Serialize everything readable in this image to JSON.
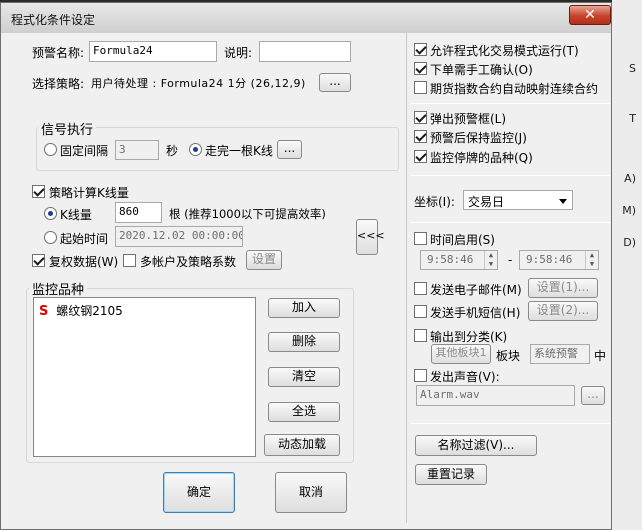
{
  "window": {
    "title": "程式化条件设定",
    "close": "✕"
  },
  "background_right_fragments": [
    "S",
    "T",
    "A)",
    "M)",
    "D)"
  ],
  "left": {
    "alert_name_label": "预警名称:",
    "alert_name_value": "Formula24",
    "description_label": "说明:",
    "description_value": "",
    "strategy_label": "选择策略:",
    "strategy_value": "用户待处理 : Formula24 1分 (26,12,9)",
    "strategy_browse": "...",
    "signal_group": "信号执行",
    "fixed_interval_label": "固定间隔",
    "fixed_interval_value": "3",
    "seconds_unit": "秒",
    "bar_complete_label": "走完一根K线",
    "bar_complete_btn": "...",
    "kline_calc_label": "策略计算K线量",
    "kline_count_label": "K线量",
    "kline_count_value": "860",
    "kline_count_hint": "根 (推荐1000以下可提高效率)",
    "start_time_label": "起始时间",
    "start_time_value": "2020.12.02 00:00:00",
    "restore_data_label": "复权数据(W)",
    "multi_account_label": "多帐户及策略系数",
    "settings_btn": "设置",
    "expand_btn": "<<<",
    "monitor_group": "监控品种",
    "monitor_items": [
      {
        "marker": "S",
        "name": "螺纹钢2105"
      }
    ],
    "add_btn": "加入",
    "delete_btn": "删除",
    "clear_btn": "清空",
    "select_all_btn": "全选",
    "dynamic_load_btn": "动态加载",
    "ok_btn": "确定",
    "cancel_btn": "取消"
  },
  "right": {
    "allow_trade_label": "允许程式化交易模式运行(T)",
    "manual_confirm_label": "下单需手工确认(O)",
    "futures_index_label": "期货指数合约自动映射连续合约",
    "popup_alert_label": "弹出预警框(L)",
    "keep_monitor_label": "预警后保持监控(J)",
    "monitor_suspended_label": "监控停牌的品种(Q)",
    "axis_label": "坐标(I):",
    "axis_value": "交易日",
    "time_enable_label": "时间启用(S)",
    "time_from": "9:58:46",
    "time_dash": "-",
    "time_to": "9:58:46",
    "send_email_label": "发送电子邮件(M)",
    "email_settings_btn": "设置(1)...",
    "send_sms_label": "发送手机短信(H)",
    "sms_settings_btn": "设置(2)...",
    "output_category_label": "输出到分类(K)",
    "other_block_btn": "其他板块1",
    "block_label": "板块",
    "system_alert_value": "系统预警",
    "middle_char": "中",
    "play_sound_label": "发出声音(V):",
    "sound_file_value": "Alarm.wav",
    "sound_browse_btn": "...",
    "name_filter_btn": "名称过滤(V)...",
    "reset_record_btn": "重置记录"
  },
  "state": {
    "fixed_interval": false,
    "bar_complete": true,
    "kline_calc": true,
    "kline_count": true,
    "start_time": false,
    "restore_data": true,
    "multi_account": false,
    "allow_trade": true,
    "manual_confirm": true,
    "futures_index": false,
    "popup_alert": true,
    "keep_monitor": true,
    "monitor_suspended": true,
    "time_enable": false,
    "send_email": false,
    "send_sms": false,
    "output_category": false,
    "play_sound": false
  },
  "colors": {
    "close_button": "#c7432b",
    "marker_red": "#e00000",
    "radio_dot": "#1e3c9c"
  }
}
